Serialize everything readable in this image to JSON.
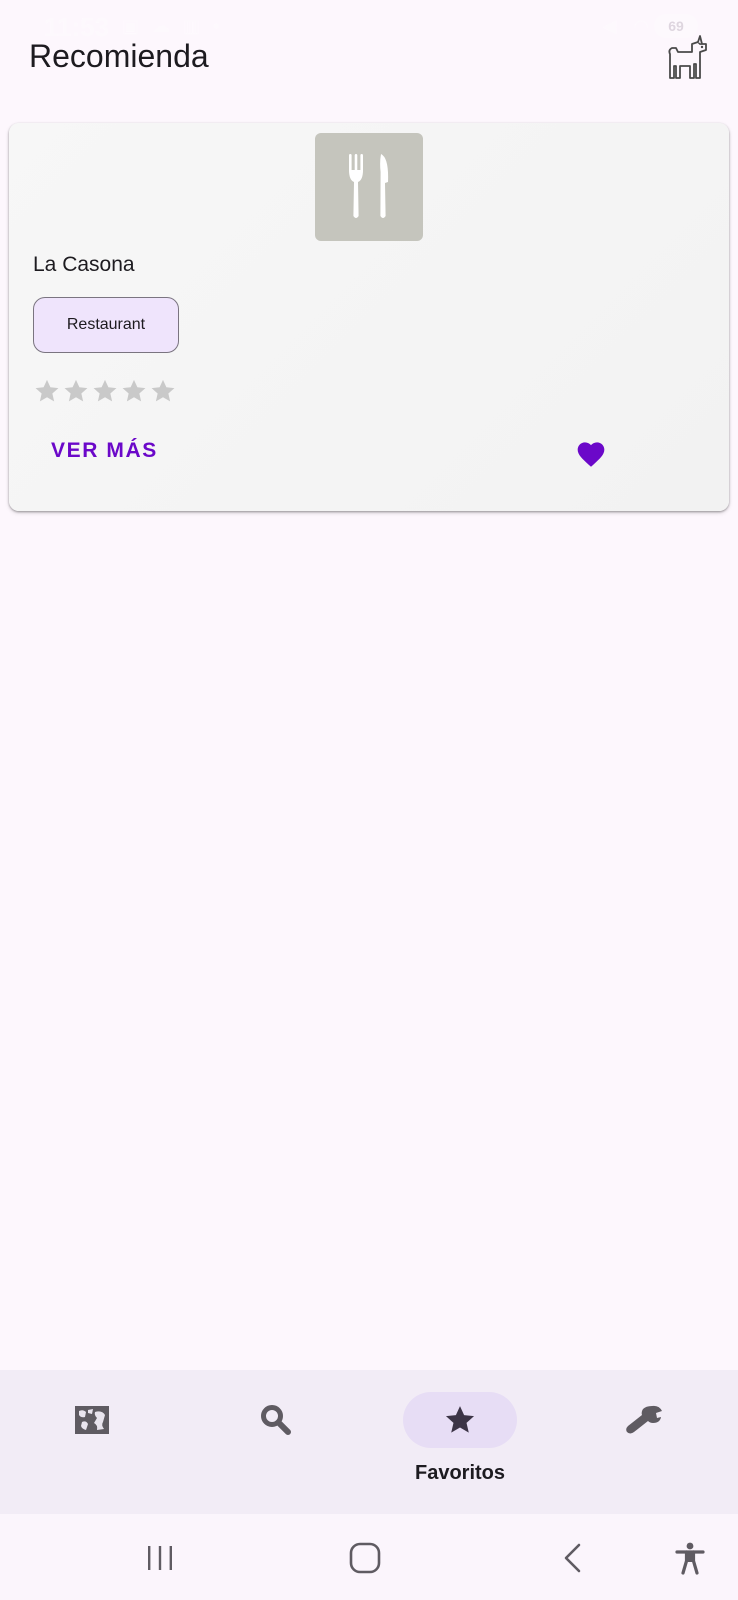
{
  "status_bar": {
    "time": "11:53",
    "left_icons": "▣ ☁ ▥ •",
    "right_icons": "◀ ◠ ▮",
    "battery": "69"
  },
  "app_bar": {
    "title": "Recomienda",
    "action_icon": "dog-icon"
  },
  "card": {
    "image_icon": "cutlery-icon",
    "image_bg": "#c5c5bd",
    "name": "La Casona",
    "category": "Restaurant",
    "rating": 0,
    "rating_max": 5,
    "action_label": "VER MÁS",
    "favorite": true,
    "accent": "#6b08c9"
  },
  "bottom_nav": {
    "items": [
      {
        "icon": "map-icon",
        "label": ""
      },
      {
        "icon": "search-icon",
        "label": ""
      },
      {
        "icon": "star-icon",
        "label": "Favoritos",
        "active": true
      },
      {
        "icon": "wrench-icon",
        "label": ""
      }
    ]
  },
  "system_nav": {
    "buttons": [
      "recents-icon",
      "home-icon",
      "back-icon",
      "accessibility-icon"
    ]
  }
}
